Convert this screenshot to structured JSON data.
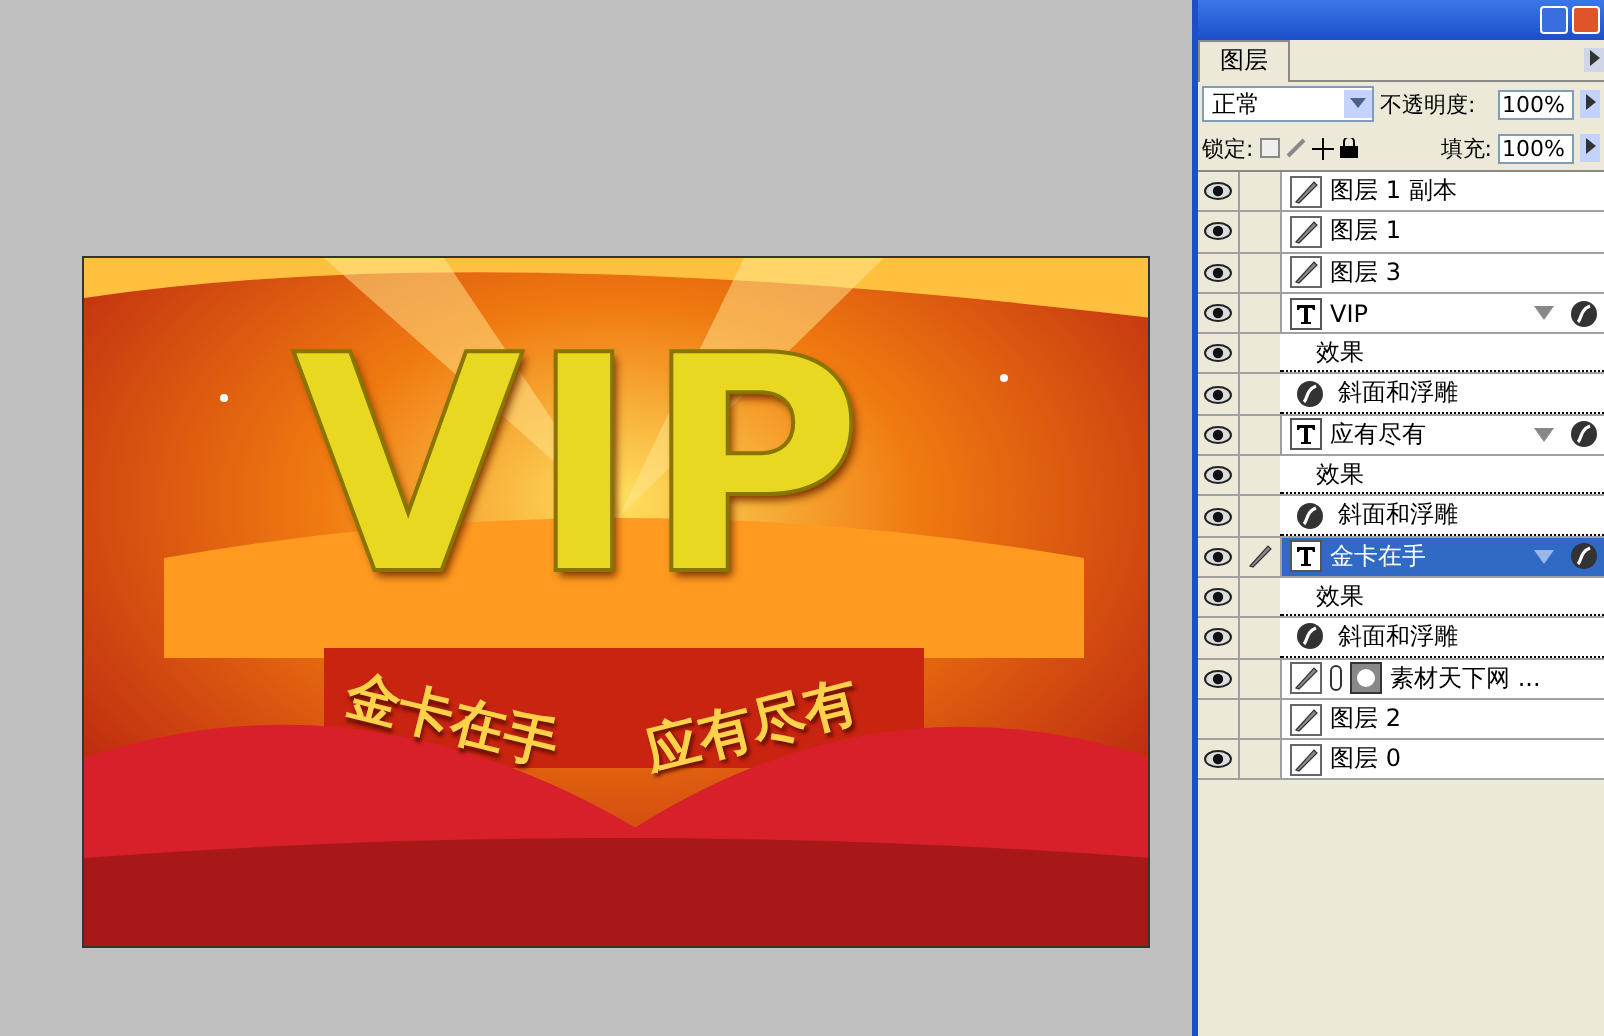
{
  "canvas": {
    "kind": "picture",
    "headline": "VIP",
    "slogan": [
      "金卡在手",
      "应有尽有"
    ]
  },
  "layers_panel": {
    "tabs": [
      {
        "label": "图层",
        "selected": true
      }
    ],
    "blend_mode": "正常",
    "opacity_label": "不透明度:",
    "opacity": "100%",
    "lock_label": "锁定:",
    "fill_label": "填充:",
    "fill": "100%",
    "layers": [
      {
        "kind": "pixel",
        "name": "图层 1 副本",
        "visible": true,
        "selected": false
      },
      {
        "kind": "pixel",
        "name": "图层 1",
        "visible": true,
        "selected": false
      },
      {
        "kind": "pixel",
        "name": "图层 3",
        "visible": true,
        "selected": false
      },
      {
        "kind": "text",
        "name": "VIP",
        "visible": true,
        "selected": false,
        "expanded": true,
        "effects_label": "效果",
        "effects_visible": true,
        "effects": [
          {
            "name": "斜面和浮雕",
            "visible": true
          }
        ]
      },
      {
        "kind": "text",
        "name": "应有尽有",
        "visible": true,
        "selected": false,
        "expanded": true,
        "effects_label": "效果",
        "effects_visible": true,
        "effects": [
          {
            "name": "斜面和浮雕",
            "visible": true
          }
        ]
      },
      {
        "kind": "text",
        "name": "金卡在手",
        "visible": true,
        "selected": true,
        "expanded": true,
        "effects_label": "效果",
        "effects_visible": true,
        "effects": [
          {
            "name": "斜面和浮雕",
            "visible": true
          }
        ]
      },
      {
        "kind": "masked",
        "name": "素材天下网 ...",
        "visible": true,
        "selected": false
      },
      {
        "kind": "pixel",
        "name": "图层 2",
        "visible": false,
        "selected": false
      },
      {
        "kind": "pixel",
        "name": "图层 0",
        "visible": true,
        "selected": false
      }
    ]
  }
}
